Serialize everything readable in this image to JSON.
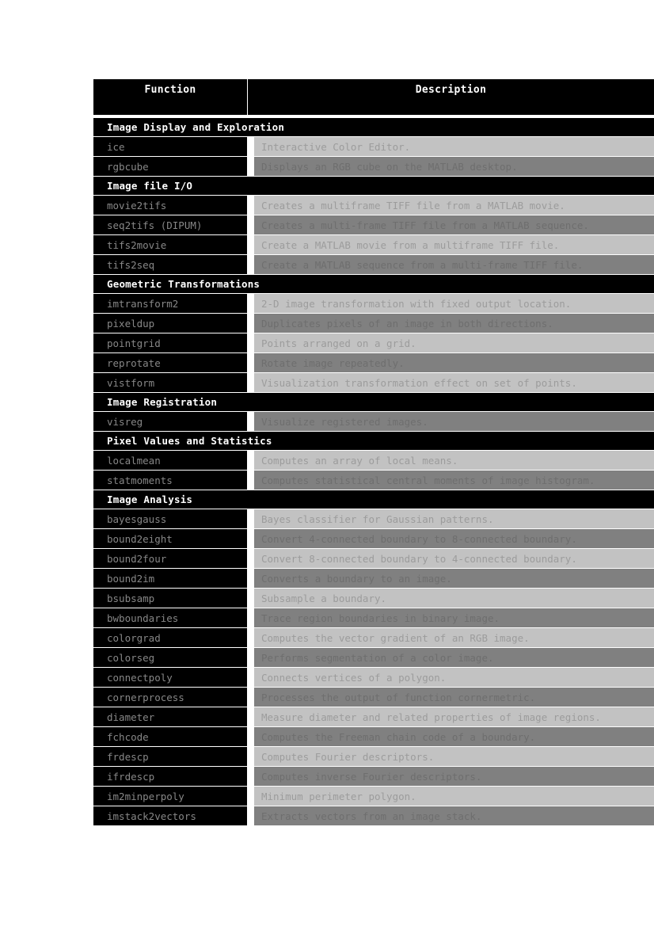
{
  "table": {
    "columns": {
      "function": "Function",
      "description": "Description"
    },
    "sections": [
      {
        "title": "Image Display and Exploration",
        "rows": [
          {
            "function": "ice",
            "description": "Interactive Color Editor."
          },
          {
            "function": "rgbcube",
            "description": "Displays an RGB cube on the MATLAB desktop."
          }
        ]
      },
      {
        "title": "Image file I/O",
        "rows": [
          {
            "function": "movie2tifs",
            "description": "Creates a multiframe TIFF file from a MATLAB movie."
          },
          {
            "function": "seq2tifs (DIPUM)",
            "description": "Creates a multi-frame TIFF file from a MATLAB sequence."
          },
          {
            "function": "tifs2movie",
            "description": "Create a MATLAB movie from a multiframe TIFF file."
          },
          {
            "function": "tifs2seq",
            "description": "Create a MATLAB sequence from a multi-frame TIFF file."
          }
        ]
      },
      {
        "title": "Geometric Transformations",
        "rows": [
          {
            "function": "imtransform2",
            "description": "2-D image transformation with fixed output location."
          },
          {
            "function": "pixeldup",
            "description": "Duplicates pixels of an image in both directions."
          },
          {
            "function": "pointgrid",
            "description": "Points arranged on a grid."
          },
          {
            "function": "reprotate",
            "description": "Rotate image repeatedly."
          },
          {
            "function": "vistform",
            "description": "Visualization transformation effect on set of points."
          }
        ]
      },
      {
        "title": "Image Registration",
        "rows": [
          {
            "function": "visreg",
            "description": "Visualize registered images."
          }
        ]
      },
      {
        "title": "Pixel Values and Statistics",
        "rows": [
          {
            "function": "localmean",
            "description": "Computes an array of local means."
          },
          {
            "function": "statmoments",
            "description": "Computes statistical central moments of image histogram."
          }
        ]
      },
      {
        "title": "Image Analysis",
        "rows": [
          {
            "function": "bayesgauss",
            "description": "Bayes classifier for Gaussian patterns."
          },
          {
            "function": "bound2eight",
            "description": "Convert 4-connected boundary to 8-connected boundary."
          },
          {
            "function": "bound2four",
            "description": "Convert 8-connected boundary to 4-connected boundary."
          },
          {
            "function": "bound2im",
            "description": "Converts a boundary to an image."
          },
          {
            "function": "bsubsamp",
            "description": "Subsample a boundary."
          },
          {
            "function": "bwboundaries",
            "description": "Trace region boundaries in binary image."
          },
          {
            "function": "colorgrad",
            "description": "Computes the vector gradient of an RGB image."
          },
          {
            "function": "colorseg",
            "description": "Performs segmentation of a color image."
          },
          {
            "function": "connectpoly",
            "description": "Connects vertices of a polygon."
          },
          {
            "function": "cornerprocess",
            "description": "Processes the output of function cornermetric."
          },
          {
            "function": "diameter",
            "description": "Measure diameter and related properties of image regions."
          },
          {
            "function": "fchcode",
            "description": "Computes the Freeman chain code of a boundary."
          },
          {
            "function": "frdescp",
            "description": "Computes Fourier descriptors."
          },
          {
            "function": "ifrdescp",
            "description": "Computes inverse Fourier descriptors."
          },
          {
            "function": "im2minperpoly",
            "description": "Minimum perimeter polygon."
          },
          {
            "function": "imstack2vectors",
            "description": "Extracts vectors from an image stack."
          }
        ]
      }
    ]
  }
}
